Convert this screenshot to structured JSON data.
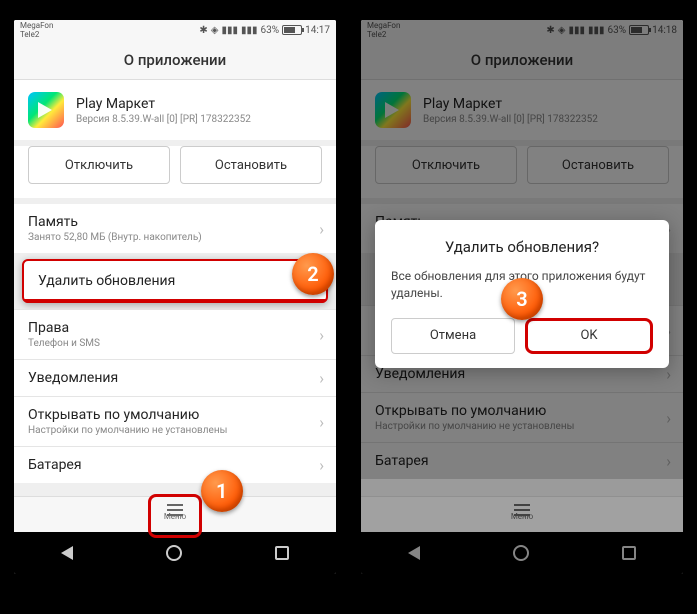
{
  "status": {
    "carrier1": "MegaFon",
    "carrier2": "Tele2",
    "battery_pct": "63%",
    "time_left": "14:17",
    "time_right": "14:18"
  },
  "title": "О приложении",
  "app": {
    "name": "Play Маркет",
    "version": "Версия 8.5.39.W-all [0] [PR] 178322352"
  },
  "buttons": {
    "disable": "Отключить",
    "stop": "Остановить"
  },
  "items": {
    "memory_title": "Память",
    "memory_sub": "Занято 52,80 МБ (Внутр. накопитель)",
    "delete_updates": "Удалить обновления",
    "rights_title": "Права",
    "rights_sub": "Телефон и SMS",
    "notifications": "Уведомления",
    "open_default_title": "Открывать по умолчанию",
    "open_default_sub": "Настройки по умолчанию не установлены",
    "battery": "Батарея"
  },
  "menu_label": "Меню",
  "dialog": {
    "title": "Удалить обновления?",
    "message": "Все обновления для этого приложения будут удалены.",
    "cancel": "Отмена",
    "ok": "OK"
  },
  "steps": {
    "s1": "1",
    "s2": "2",
    "s3": "3"
  }
}
